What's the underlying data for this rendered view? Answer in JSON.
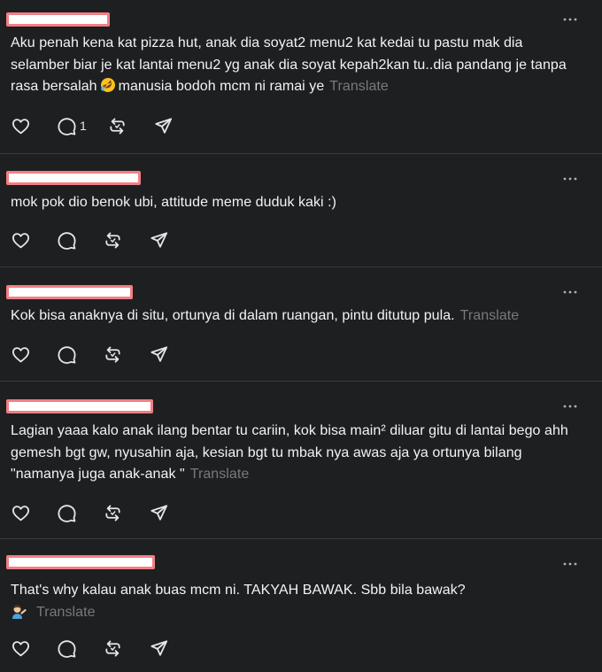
{
  "colors": {
    "background": "#1e1f20",
    "divider": "#383a3c",
    "text": "#f3f3f3",
    "muted": "#777a7e",
    "redaction_fill": "#ffffff",
    "redaction_border": "#f07f84"
  },
  "posts": [
    {
      "text_before_emoji": "Aku penah kena kat pizza hut, anak dia soyat2 menu2 kat kedai tu pastu mak dia selamber biar je kat lantai menu2 yg anak dia soyat kepah2kan tu..dia pandang je tanpa rasa bersalah",
      "emoji": "rolling-on-floor-laughing",
      "text_after_emoji": "manusia bodoh mcm ni ramai ye",
      "translate_label": "Translate",
      "reply_count": "1"
    },
    {
      "text": "mok pok dio benok ubi, attitude meme duduk kaki :)"
    },
    {
      "text": "Kok bisa anaknya di situ, ortunya di dalam ruangan, pintu ditutup pula.",
      "translate_label": "Translate"
    },
    {
      "text": "Lagian yaaa kalo anak ilang bentar tu cariin, kok bisa main² diluar gitu di lantai bego ahh gemesh bgt gw, nyusahin aja, kesian bgt tu mbak nya awas aja ya ortunya bilang \"namanya juga anak-anak \"",
      "translate_label": "Translate"
    },
    {
      "text": "That's why kalau anak buas mcm ni. TAKYAH BAWAK. Sbb bila bawak?",
      "emoji": "person-tipping-hand",
      "translate_label": "Translate"
    }
  ],
  "icons": {
    "like": "heart-icon",
    "reply": "comment-icon",
    "repost": "repost-icon",
    "share": "send-icon",
    "more": "more-dots-icon"
  }
}
